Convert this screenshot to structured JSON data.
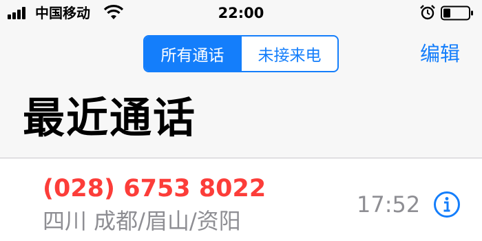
{
  "status_bar": {
    "carrier": "中国移动",
    "time": "22:00"
  },
  "nav": {
    "segments": [
      {
        "label": "所有通话",
        "selected": true
      },
      {
        "label": "未接来电",
        "selected": false
      }
    ],
    "edit_label": "编辑"
  },
  "page": {
    "title": "最近通话"
  },
  "calls": [
    {
      "number": "(028) 6753 8022",
      "location": "四川 成都/眉山/资阳",
      "time": "17:52",
      "missed": true
    }
  ],
  "colors": {
    "accent": "#147efb",
    "missed": "#fc3d39",
    "secondary_text": "#8e8e93"
  },
  "icons": [
    "signal-icon",
    "wifi-icon",
    "alarm-icon",
    "battery-icon",
    "info-icon"
  ]
}
